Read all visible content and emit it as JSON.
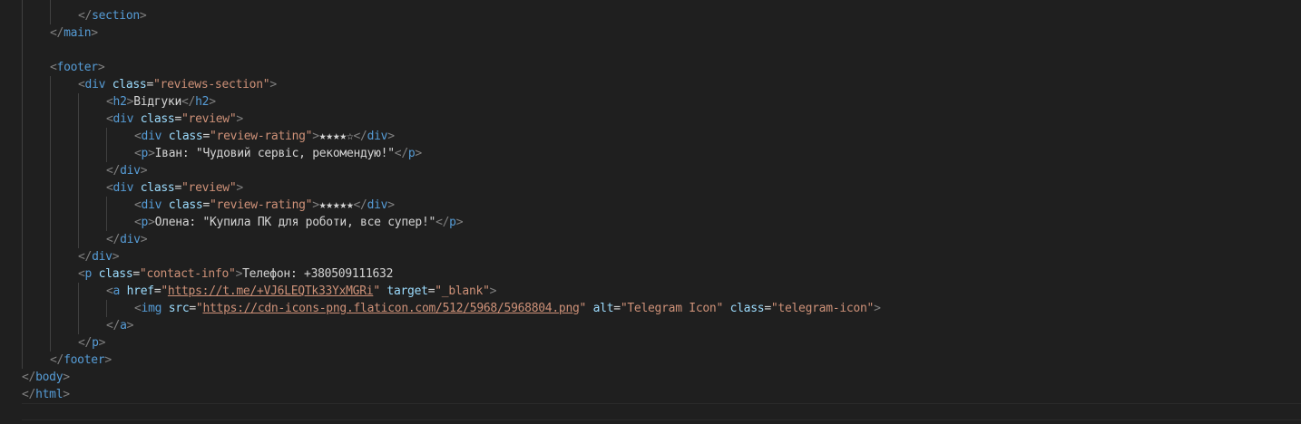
{
  "editor": {
    "language": "html",
    "lines": [
      {
        "indent": 2,
        "tokens": [
          [
            "br",
            "</"
          ],
          [
            "tag",
            "section"
          ],
          [
            "br",
            ">"
          ]
        ]
      },
      {
        "indent": 1,
        "tokens": [
          [
            "br",
            "</"
          ],
          [
            "tag",
            "main"
          ],
          [
            "br",
            ">"
          ]
        ]
      },
      {
        "indent": 0,
        "tokens": []
      },
      {
        "indent": 1,
        "tokens": [
          [
            "br",
            "<"
          ],
          [
            "tag",
            "footer"
          ],
          [
            "br",
            ">"
          ]
        ]
      },
      {
        "indent": 2,
        "tokens": [
          [
            "br",
            "<"
          ],
          [
            "tag",
            "div"
          ],
          [
            "txt",
            " "
          ],
          [
            "attr",
            "class"
          ],
          [
            "eq",
            "="
          ],
          [
            "str",
            "\"reviews-section\""
          ],
          [
            "br",
            ">"
          ]
        ]
      },
      {
        "indent": 3,
        "tokens": [
          [
            "br",
            "<"
          ],
          [
            "tag",
            "h2"
          ],
          [
            "br",
            ">"
          ],
          [
            "txt",
            "Відгуки"
          ],
          [
            "br",
            "</"
          ],
          [
            "tag",
            "h2"
          ],
          [
            "br",
            ">"
          ]
        ]
      },
      {
        "indent": 3,
        "tokens": [
          [
            "br",
            "<"
          ],
          [
            "tag",
            "div"
          ],
          [
            "txt",
            " "
          ],
          [
            "attr",
            "class"
          ],
          [
            "eq",
            "="
          ],
          [
            "str",
            "\"review\""
          ],
          [
            "br",
            ">"
          ]
        ]
      },
      {
        "indent": 4,
        "tokens": [
          [
            "br",
            "<"
          ],
          [
            "tag",
            "div"
          ],
          [
            "txt",
            " "
          ],
          [
            "attr",
            "class"
          ],
          [
            "eq",
            "="
          ],
          [
            "str",
            "\"review-rating\""
          ],
          [
            "br",
            ">"
          ],
          [
            "txt",
            "★★★★☆"
          ],
          [
            "br",
            "</"
          ],
          [
            "tag",
            "div"
          ],
          [
            "br",
            ">"
          ]
        ]
      },
      {
        "indent": 4,
        "tokens": [
          [
            "br",
            "<"
          ],
          [
            "tag",
            "p"
          ],
          [
            "br",
            ">"
          ],
          [
            "txt",
            "Іван: \"Чудовий сервіс, рекомендую!\""
          ],
          [
            "br",
            "</"
          ],
          [
            "tag",
            "p"
          ],
          [
            "br",
            ">"
          ]
        ]
      },
      {
        "indent": 3,
        "tokens": [
          [
            "br",
            "</"
          ],
          [
            "tag",
            "div"
          ],
          [
            "br",
            ">"
          ]
        ]
      },
      {
        "indent": 3,
        "tokens": [
          [
            "br",
            "<"
          ],
          [
            "tag",
            "div"
          ],
          [
            "txt",
            " "
          ],
          [
            "attr",
            "class"
          ],
          [
            "eq",
            "="
          ],
          [
            "str",
            "\"review\""
          ],
          [
            "br",
            ">"
          ]
        ]
      },
      {
        "indent": 4,
        "tokens": [
          [
            "br",
            "<"
          ],
          [
            "tag",
            "div"
          ],
          [
            "txt",
            " "
          ],
          [
            "attr",
            "class"
          ],
          [
            "eq",
            "="
          ],
          [
            "str",
            "\"review-rating\""
          ],
          [
            "br",
            ">"
          ],
          [
            "txt",
            "★★★★★"
          ],
          [
            "br",
            "</"
          ],
          [
            "tag",
            "div"
          ],
          [
            "br",
            ">"
          ]
        ]
      },
      {
        "indent": 4,
        "tokens": [
          [
            "br",
            "<"
          ],
          [
            "tag",
            "p"
          ],
          [
            "br",
            ">"
          ],
          [
            "txt",
            "Олена: \"Купила ПК для роботи, все супер!\""
          ],
          [
            "br",
            "</"
          ],
          [
            "tag",
            "p"
          ],
          [
            "br",
            ">"
          ]
        ]
      },
      {
        "indent": 3,
        "tokens": [
          [
            "br",
            "</"
          ],
          [
            "tag",
            "div"
          ],
          [
            "br",
            ">"
          ]
        ]
      },
      {
        "indent": 2,
        "tokens": [
          [
            "br",
            "</"
          ],
          [
            "tag",
            "div"
          ],
          [
            "br",
            ">"
          ]
        ]
      },
      {
        "indent": 2,
        "tokens": [
          [
            "br",
            "<"
          ],
          [
            "tag",
            "p"
          ],
          [
            "txt",
            " "
          ],
          [
            "attr",
            "class"
          ],
          [
            "eq",
            "="
          ],
          [
            "str",
            "\"contact-info\""
          ],
          [
            "br",
            ">"
          ],
          [
            "txt",
            "Телефон: +380509111632"
          ]
        ]
      },
      {
        "indent": 3,
        "tokens": [
          [
            "br",
            "<"
          ],
          [
            "tag",
            "a"
          ],
          [
            "txt",
            " "
          ],
          [
            "attr",
            "href"
          ],
          [
            "eq",
            "="
          ],
          [
            "str",
            "\""
          ],
          [
            "url",
            "https://t.me/+VJ6LEQTk33YxMGRi"
          ],
          [
            "str",
            "\""
          ],
          [
            "txt",
            " "
          ],
          [
            "attr",
            "target"
          ],
          [
            "eq",
            "="
          ],
          [
            "str",
            "\"_blank\""
          ],
          [
            "br",
            ">"
          ]
        ]
      },
      {
        "indent": 4,
        "tokens": [
          [
            "br",
            "<"
          ],
          [
            "tag",
            "img"
          ],
          [
            "txt",
            " "
          ],
          [
            "attr",
            "src"
          ],
          [
            "eq",
            "="
          ],
          [
            "str",
            "\""
          ],
          [
            "url",
            "https://cdn-icons-png.flaticon.com/512/5968/5968804.png"
          ],
          [
            "str",
            "\""
          ],
          [
            "txt",
            " "
          ],
          [
            "attr",
            "alt"
          ],
          [
            "eq",
            "="
          ],
          [
            "str",
            "\"Telegram Icon\""
          ],
          [
            "txt",
            " "
          ],
          [
            "attr",
            "class"
          ],
          [
            "eq",
            "="
          ],
          [
            "str",
            "\"telegram-icon\""
          ],
          [
            "br",
            ">"
          ]
        ]
      },
      {
        "indent": 3,
        "tokens": [
          [
            "br",
            "</"
          ],
          [
            "tag",
            "a"
          ],
          [
            "br",
            ">"
          ]
        ]
      },
      {
        "indent": 2,
        "tokens": [
          [
            "br",
            "</"
          ],
          [
            "tag",
            "p"
          ],
          [
            "br",
            ">"
          ]
        ]
      },
      {
        "indent": 1,
        "tokens": [
          [
            "br",
            "</"
          ],
          [
            "tag",
            "footer"
          ],
          [
            "br",
            ">"
          ]
        ]
      },
      {
        "indent": 0,
        "tokens": [
          [
            "br",
            "</"
          ],
          [
            "tag",
            "body"
          ],
          [
            "br",
            ">"
          ]
        ]
      },
      {
        "indent": 0,
        "tokens": [
          [
            "br",
            "</"
          ],
          [
            "tag",
            "html"
          ],
          [
            "br",
            ">"
          ]
        ]
      },
      {
        "indent": 0,
        "tokens": []
      }
    ]
  },
  "colors": {
    "background": "#1f1f1f",
    "bracket": "#808080",
    "tag": "#569cd6",
    "attribute": "#9cdcfe",
    "string": "#ce9178",
    "text": "#d4d4d4"
  }
}
